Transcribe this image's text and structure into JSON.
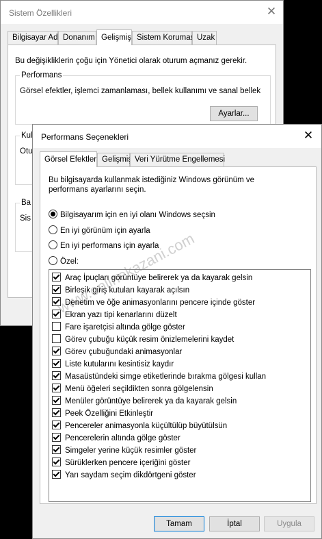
{
  "back_window": {
    "title": "Sistem Özellikleri",
    "tabs": [
      "Bilgisayar Adı",
      "Donanım",
      "Gelişmiş",
      "Sistem Koruması",
      "Uzak"
    ],
    "active_tab": "Gelişmiş",
    "intro": "Bu değişikliklerin çoğu için Yönetici olarak oturum açmanız gerekir.",
    "performance_label": "Performans",
    "performance_desc": "Görsel efektler, işlemci zamanlaması, bellek kullanımı ve sanal bellek",
    "settings_button": "Ayarlar...",
    "partial_labels": [
      "Kul",
      "Otu",
      "Ba",
      "Sis"
    ]
  },
  "front_window": {
    "title": "Performans Seçenekleri",
    "tabs": [
      "Görsel Efektler",
      "Gelişmiş",
      "Veri Yürütme Engellemesi"
    ],
    "active_tab": "Görsel Efektler",
    "intro": "Bu bilgisayarda kullanmak istediğiniz Windows görünüm ve performans ayarlarını seçin.",
    "radios": [
      {
        "label": "Bilgisayarım için en iyi olanı Windows seçsin",
        "selected": true
      },
      {
        "label": "En iyi görünüm için ayarla",
        "selected": false
      },
      {
        "label": "En iyi performans için ayarla",
        "selected": false
      },
      {
        "label": "Özel:",
        "selected": false
      }
    ],
    "effects": [
      {
        "label": "Araç İpuçları görüntüye belirerek ya da kayarak gelsin",
        "checked": true
      },
      {
        "label": "Birleşik giriş kutuları kayarak açılsın",
        "checked": true
      },
      {
        "label": "Denetim ve öğe animasyonlarını pencere içinde göster",
        "checked": true
      },
      {
        "label": "Ekran yazı tipi kenarlarını düzelt",
        "checked": true
      },
      {
        "label": "Fare işaretçisi altında gölge göster",
        "checked": false
      },
      {
        "label": "Görev çubuğu küçük resim önizlemelerini kaydet",
        "checked": false
      },
      {
        "label": "Görev çubuğundaki animasyonlar",
        "checked": true
      },
      {
        "label": "Liste kutularını kesintisiz kaydır",
        "checked": true
      },
      {
        "label": "Masaüstündeki simge etiketlerinde bırakma gölgesi kullan",
        "checked": true
      },
      {
        "label": "Menü öğeleri seçildikten sonra gölgelensin",
        "checked": true
      },
      {
        "label": "Menüler görüntüye belirerek ya da kayarak gelsin",
        "checked": true
      },
      {
        "label": "Peek Özelliğini Etkinleştir",
        "checked": true
      },
      {
        "label": "Pencereler animasyonla küçültülüp büyütülsün",
        "checked": true
      },
      {
        "label": "Pencerelerin altında gölge göster",
        "checked": true
      },
      {
        "label": "Simgeler yerine küçük resimler göster",
        "checked": true
      },
      {
        "label": "Sürüklerken pencere içeriğini göster",
        "checked": true
      },
      {
        "label": "Yarı saydam seçim dikdörtgeni göster",
        "checked": true
      }
    ],
    "buttons": {
      "ok": "Tamam",
      "cancel": "İptal",
      "apply": "Uygula"
    }
  },
  "watermark": "www.onlinekazani.com"
}
